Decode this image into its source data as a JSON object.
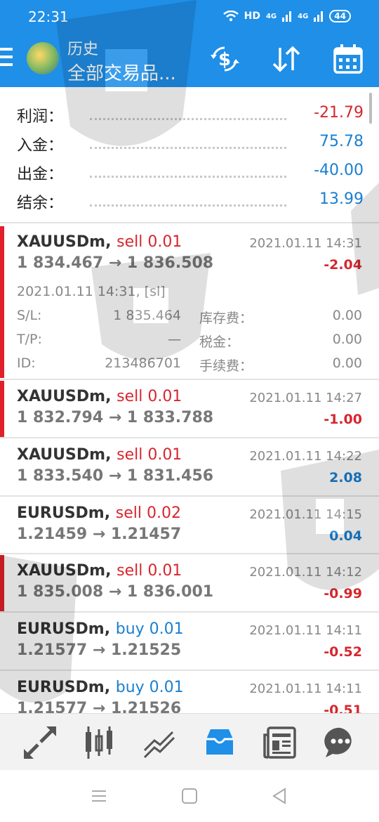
{
  "status": {
    "time": "22:31",
    "hd": "HD",
    "net1": "4G",
    "net2": "4G",
    "battery": "44"
  },
  "header": {
    "title": "历史",
    "subtitle": "全部交易品..."
  },
  "summary": [
    {
      "label": "利润：",
      "value": "-21.79",
      "color": "#d6272e"
    },
    {
      "label": "入金：",
      "value": "75.78",
      "color": "#1a7fd0"
    },
    {
      "label": "出金：",
      "value": "-40.00",
      "color": "#1a7fd0"
    },
    {
      "label": "结余：",
      "value": "13.99",
      "color": "#1a7fd0"
    }
  ],
  "trades": [
    {
      "symbol": "XAUUSDm,",
      "side": "sell 0.01",
      "side_color": "#d6272e",
      "prices": "1 834.467 → 1 836.508",
      "datetime": "2021.01.11 14:31",
      "pnl": "-2.04",
      "pnl_color": "#d6272e",
      "flagged": true
    },
    {
      "symbol": "XAUUSDm,",
      "side": "sell 0.01",
      "side_color": "#d6272e",
      "prices": "1 832.794 → 1 833.788",
      "datetime": "2021.01.11 14:27",
      "pnl": "-1.00",
      "pnl_color": "#d6272e",
      "flagged": true
    },
    {
      "symbol": "XAUUSDm,",
      "side": "sell 0.01",
      "side_color": "#d6272e",
      "prices": "1 833.540 → 1 831.456",
      "datetime": "2021.01.11 14:22",
      "pnl": "2.08",
      "pnl_color": "#1a7fd0",
      "flagged": false
    },
    {
      "symbol": "EURUSDm,",
      "side": "sell 0.02",
      "side_color": "#d6272e",
      "prices": "1.21459 → 1.21457",
      "datetime": "2021.01.11 14:15",
      "pnl": "0.04",
      "pnl_color": "#1a7fd0",
      "flagged": false
    },
    {
      "symbol": "XAUUSDm,",
      "side": "sell 0.01",
      "side_color": "#d6272e",
      "prices": "1 835.008 → 1 836.001",
      "datetime": "2021.01.11 14:12",
      "pnl": "-0.99",
      "pnl_color": "#d6272e",
      "flagged": true
    },
    {
      "symbol": "EURUSDm,",
      "side": "buy 0.01",
      "side_color": "#1a7fd0",
      "prices": "1.21577 → 1.21525",
      "datetime": "2021.01.11 14:11",
      "pnl": "-0.52",
      "pnl_color": "#d6272e",
      "flagged": false
    },
    {
      "symbol": "EURUSDm,",
      "side": "buy 0.01",
      "side_color": "#1a7fd0",
      "prices": "1.21577 → 1.21526",
      "datetime": "2021.01.11 14:11",
      "pnl": "-0.51",
      "pnl_color": "#d6272e",
      "flagged": false
    }
  ],
  "detail": {
    "opened": "2021.01.11 14:31, [sl]",
    "sl_label": "S/L:",
    "sl_value": "1 835.464",
    "tp_label": "T/P:",
    "tp_value": "—",
    "id_label": "ID:",
    "id_value": "213486701",
    "swap_label": "库存费：",
    "swap_value": "0.00",
    "tax_label": "税金：",
    "tax_value": "0.00",
    "fee_label": "手续费：",
    "fee_value": "0.00"
  },
  "nav": [
    "quotes-icon",
    "chart-icon",
    "trade-icon",
    "history-icon",
    "news-icon",
    "chat-icon"
  ],
  "colors": {
    "accent": "#1f8fe8",
    "loss": "#d6272e",
    "profit": "#1a7fd0"
  }
}
